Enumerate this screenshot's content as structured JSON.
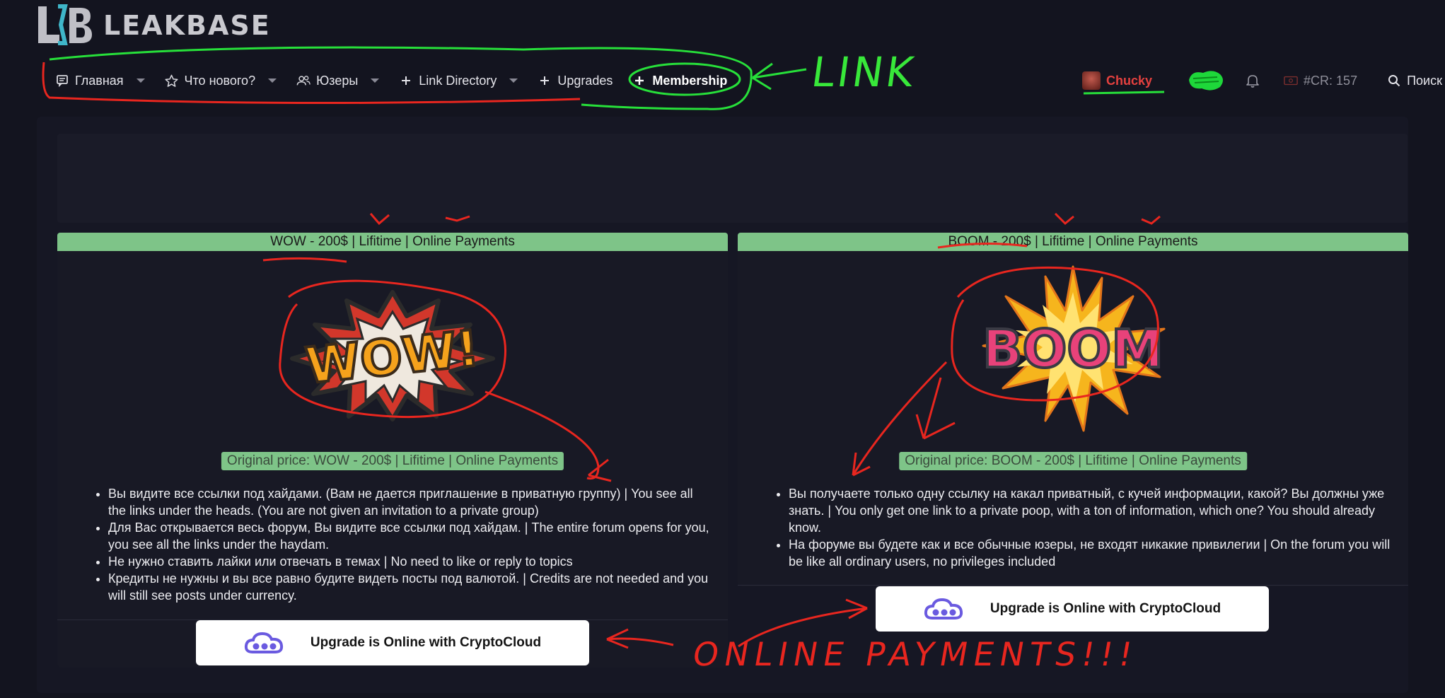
{
  "brand": {
    "name": "LEAKBASE"
  },
  "nav": {
    "items": [
      {
        "label": "Главная",
        "icon": "message-icon",
        "caret": true
      },
      {
        "label": "Что нового?",
        "icon": "star-icon",
        "caret": true
      },
      {
        "label": "Юзеры",
        "icon": "users-icon",
        "caret": true
      },
      {
        "label": "Link Directory",
        "icon": "plus-icon",
        "caret": true
      },
      {
        "label": "Upgrades",
        "icon": "plus-icon",
        "caret": false
      },
      {
        "label": "Membership",
        "icon": "plus-icon",
        "caret": false
      }
    ]
  },
  "user": {
    "name": "Chucky",
    "credits": "#CR: 157",
    "search_label": "Поиск"
  },
  "plans": [
    {
      "header": "WOW - 200$ | Lifitime | Online Payments",
      "art_text": "WOW!",
      "price_label": "Original price: WOW - 200$ | Lifitime | Online Payments",
      "features": [
        "Вы видите все ссылки под хайдами. (Вам не дается приглашение в приватную группу) | You see all the links under the heads. (You are not given an invitation to a private group)",
        "Для Вас открывается весь форум, Вы видите все ссылки под хайдам. | The entire forum opens for you, you see all the links under the haydam.",
        "Не нужно ставить лайки или отвечать в темах | No need to like or reply to topics",
        "Кредиты не нужны и вы все равно будите видеть посты под валютой. | Credits are not needed and you will still see posts under currency."
      ],
      "button_label": "Upgrade is Online with CryptoCloud"
    },
    {
      "header": "BOOM - 200$ | Lifitime | Online Payments",
      "art_text": "BOOM",
      "price_label": "Original price: BOOM - 200$ | Lifitime | Online Payments",
      "features": [
        "Вы получаете только одну ссылку на какал приватный, с кучей информации, какой? Вы должны уже знать. | You only get one link to a private poop, with a ton of information, which one? You should already know.",
        "На форуме вы будете как и все обычные юзеры, не входят никакие привилегии | On the forum you will be like all ordinary users, no privileges included"
      ],
      "button_label": "Upgrade is Online with CryptoCloud"
    }
  ],
  "annotations": {
    "link": "LINK",
    "online": "ONLINE PAYMENTS!!!"
  },
  "colors": {
    "accent_green": "#7ec488",
    "user_red": "#e5413f",
    "background": "#13141f"
  }
}
